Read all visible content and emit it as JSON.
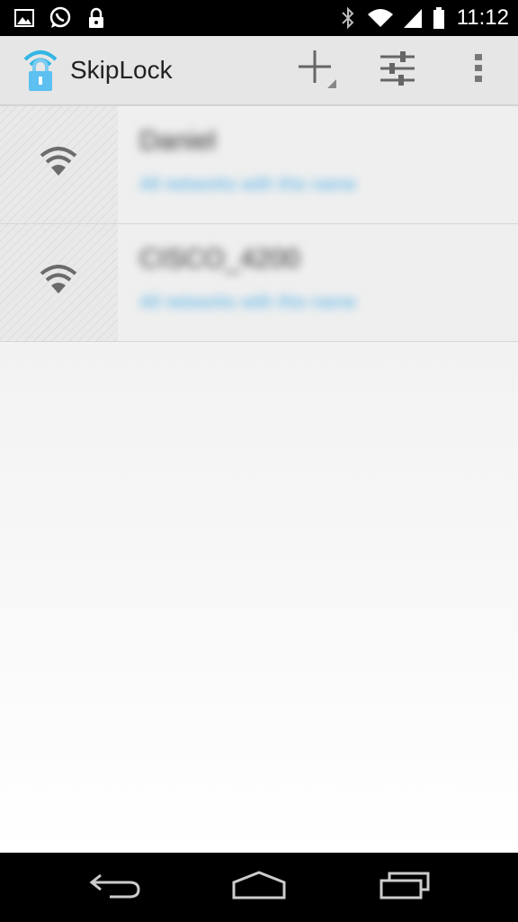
{
  "status_bar": {
    "time": "11:12",
    "left_icons": [
      "image-icon",
      "whatsapp-icon",
      "lock-icon"
    ],
    "right_icons": [
      "bluetooth-icon",
      "wifi-icon",
      "signal-icon",
      "battery-icon"
    ]
  },
  "action_bar": {
    "title": "SkipLock",
    "icon": "wifi-lock-app-icon",
    "actions": [
      "add-icon",
      "settings-sliders-icon",
      "overflow-menu-icon"
    ]
  },
  "networks": [
    {
      "name": "Daniel",
      "subtitle": "All networks with this name",
      "icon": "wifi-icon"
    },
    {
      "name": "CISCO_4200",
      "subtitle": "All networks with this name",
      "icon": "wifi-icon"
    }
  ],
  "nav_bar": {
    "buttons": [
      "back-icon",
      "home-icon",
      "recent-apps-icon"
    ]
  },
  "colors": {
    "action_bar_bg": "#e6e6e6",
    "accent": "#33b5e5",
    "subtitle": "#4fb0e8",
    "status_bar_bg": "#000000"
  }
}
